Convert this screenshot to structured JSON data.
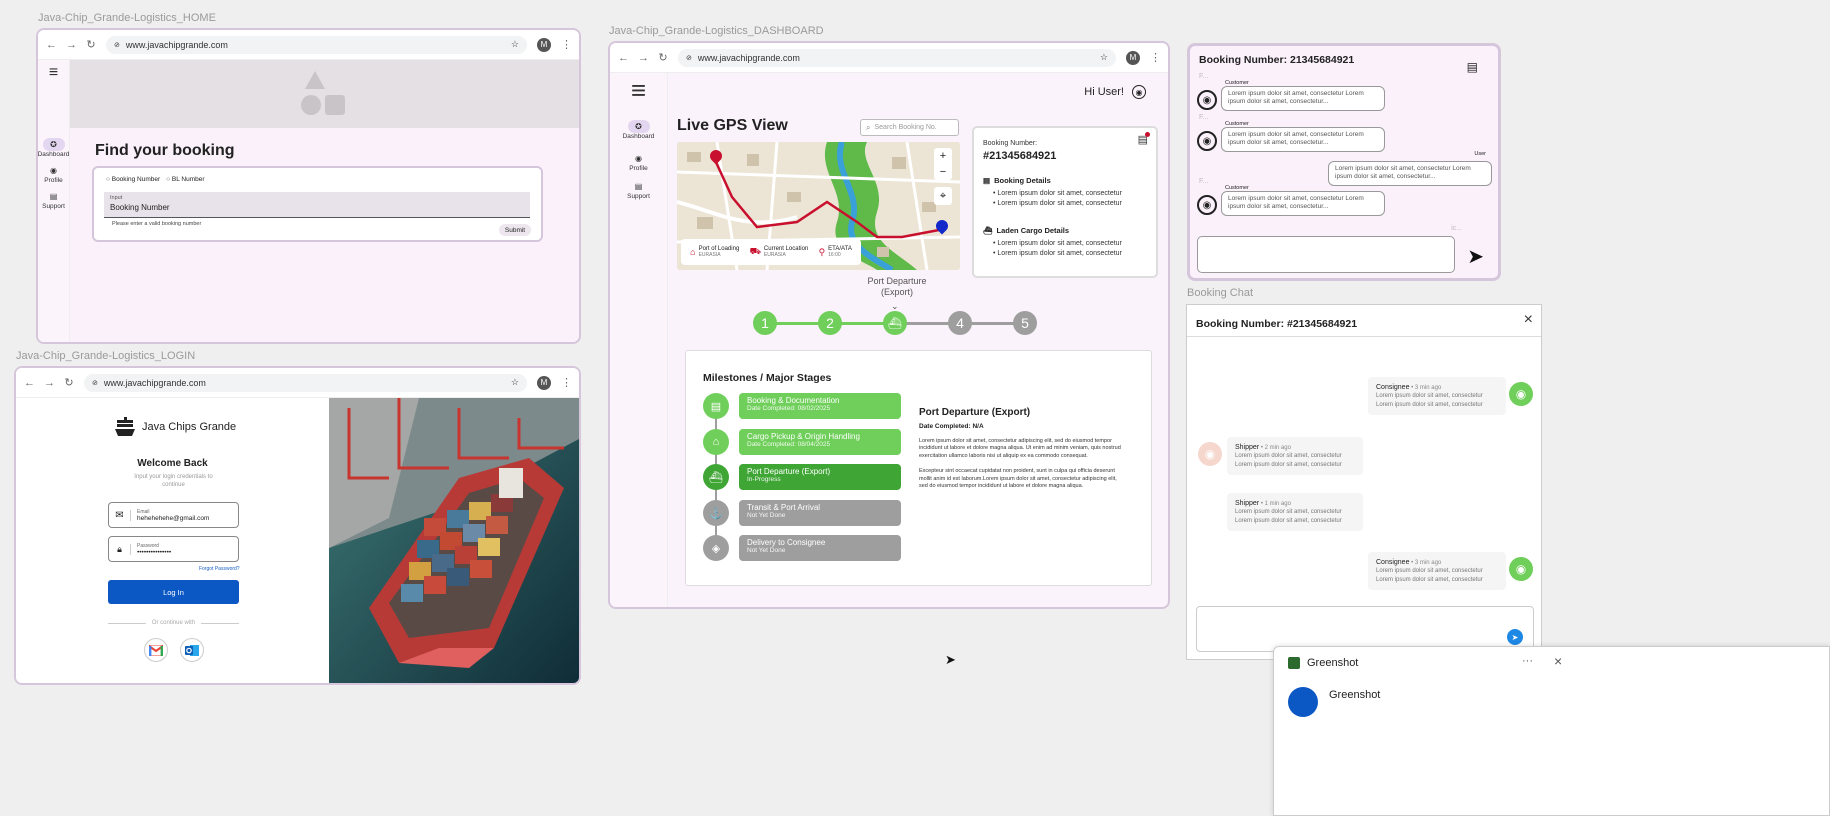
{
  "labels": {
    "home": "Java-Chip_Grande-Logistics_HOME",
    "login": "Java-Chip_Grande-Logistics_LOGIN",
    "dashboard": "Java-Chip_Grande-Logistics_DASHBOARD",
    "booking_chat": "Booking Chat"
  },
  "browser": {
    "url": "www.javachipgrande.com",
    "profile_initial": "M"
  },
  "rail": {
    "dashboard": "Dashboard",
    "profile": "Profile",
    "support": "Support"
  },
  "home": {
    "title": "Find your booking",
    "radio_booking": "Booking Number",
    "radio_bl": "BL Number",
    "input_label": "Input",
    "input_value": "Booking Number",
    "helper": "Please enter a valid booking number",
    "submit": "Submit"
  },
  "login": {
    "brand": "Java Chips Grande",
    "welcome": "Welcome Back",
    "subtitle": "Input your login credentials to continue",
    "email_label": "Email",
    "email_value": "hehehehehe@gmail.com",
    "password_label": "Password",
    "password_value": "•••••••••••••••",
    "forgot": "Forgot Password?",
    "login_button": "Log In",
    "or_continue": "Or continue with"
  },
  "dashboard": {
    "greeting": "Hi User!",
    "title": "Live GPS View",
    "search_placeholder": "Search Booking No.",
    "map_legend": [
      {
        "title": "Port of Loading",
        "sub": "EURASIA"
      },
      {
        "title": "Current Location",
        "sub": "EURASIA"
      },
      {
        "title": "ETA/ATA",
        "sub": "16:00"
      }
    ],
    "booking_label": "Booking Number:",
    "booking_number": "#21345684921",
    "booking_details": "Booking Details",
    "laden_details": "Laden Cargo Details",
    "bullet": "Lorem ipsum dolor sit amet, consectetur",
    "current_stage": "Port Departure\n(Export)",
    "steps": [
      "1",
      "2",
      "",
      "4",
      "5"
    ],
    "milestones_title": "Milestones / Major Stages",
    "milestones": [
      {
        "title": "Booking & Documentation",
        "sub": "Date Completed: 08/02/2025",
        "state": "done"
      },
      {
        "title": "Cargo Pickup & Origin Handling",
        "sub": "Date Completed: 08/04/2025",
        "state": "done"
      },
      {
        "title": "Port Departure (Export)",
        "sub": "In-Progress",
        "state": "active"
      },
      {
        "title": "Transit & Port Arrival",
        "sub": "Not Yet Done",
        "state": "todo"
      },
      {
        "title": "Delivery to Consignee",
        "sub": "Not Yet Done",
        "state": "todo"
      }
    ],
    "detail_title": "Port Departure (Export)",
    "detail_date": "Date Completed: N/A",
    "detail_p1": "Lorem ipsum dolor sit amet, consectetur adipiscing elit, sed do eiusmod tempor incididunt ut labore et dolore magna aliqua. Ut enim ad minim veniam, quis nostrud exercitation ullamco laboris nisi ut aliquip ex ea commodo consequat.",
    "detail_p2": "Excepteur sint occaecat cupidatat non proident, sunt in culpa qui officia deserunt mollit anim id est laborum.Lorem ipsum dolor sit amet, consectetur adipiscing elit, sed do eiusmod tempor incididunt ut labore et dolore magna aliqua."
  },
  "chat_small": {
    "title": "Booking Number: 21345684921",
    "f_label": "F...",
    "customer": "Customer",
    "user": "User",
    "lorem": "Lorem ipsum dolor sit amet, consectetur Lorem ipsum dolor sit amet, consectetur...",
    "ic": "ic..."
  },
  "chat_large": {
    "title": "Booking Number: #21345684921",
    "messages": [
      {
        "who": "Consignee",
        "when": "• 3 min ago",
        "side": "right"
      },
      {
        "who": "Shipper",
        "when": "• 2 min ago",
        "side": "left"
      },
      {
        "who": "Shipper",
        "when": "• 1 min ago",
        "side": "left"
      },
      {
        "who": "Consignee",
        "when": "• 3 min ago",
        "side": "right"
      }
    ],
    "msg_text": "Lorem ipsum dolor sit amet, consectetur Lorem ipsum dolor sit amet, consectetur"
  },
  "greenshot": {
    "header": "Greenshot",
    "body": "Greenshot",
    "more": "···"
  },
  "colors": {
    "green": "#6fcf5a",
    "dark_green": "#3fa535",
    "grey": "#9e9e9e",
    "blue": "#0b57c4",
    "route_red": "#c8102e"
  }
}
